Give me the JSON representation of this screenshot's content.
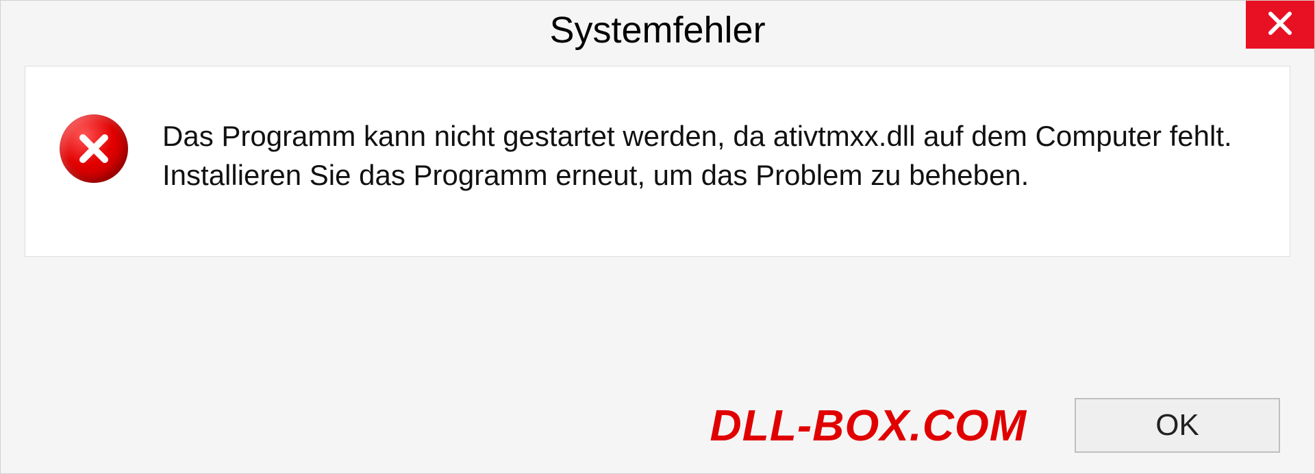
{
  "dialog": {
    "title": "Systemfehler",
    "message": "Das Programm kann nicht gestartet werden, da ativtmxx.dll auf dem Computer fehlt. Installieren Sie das Programm erneut, um das Problem zu beheben.",
    "ok_label": "OK"
  },
  "watermark": "DLL-BOX.COM"
}
